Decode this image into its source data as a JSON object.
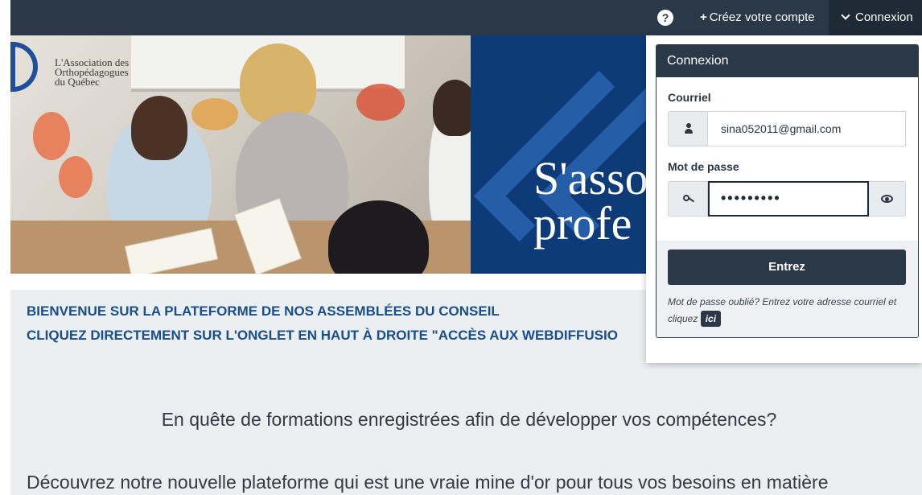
{
  "nav": {
    "help_glyph": "?",
    "create_account_label": "Créez votre compte",
    "login_label": "Connexion"
  },
  "banner": {
    "logo_lines": [
      "L'Association des",
      "Orthopédagogues",
      "du Québec"
    ],
    "slogan_lines": [
      "S'asso",
      "profe"
    ]
  },
  "content": {
    "welcome_line1": "BIENVENUE SUR LA PLATEFORME DE NOS ASSEMBLÉES DU CONSEIL",
    "welcome_line2": "CLIQUEZ DIRECTEMENT SUR L'ONGLET  EN HAUT À DROITE \"ACCÈS AUX WEBDIFFUSIO",
    "lead": "En quête de formations enregistrées afin de développer vos compétences?",
    "lead2": "Découvrez notre nouvelle plateforme qui est une vraie mine d'or pour tous vos besoins en matière"
  },
  "login": {
    "title": "Connexion",
    "email_label": "Courriel",
    "email_value": "sina052011@gmail.com",
    "password_label": "Mot de passe",
    "password_value": "•••••••••",
    "submit_label": "Entrez",
    "forgot_text": "Mot de passe oublié? Entrez votre adresse courriel et cliquez",
    "forgot_link": "ici"
  },
  "colors": {
    "navbar": "#2b3848",
    "accent_blue": "#1a4e8a",
    "banner_blue": "#0d3b78"
  },
  "icons": [
    "help-icon",
    "plus-icon",
    "chevron-down-icon",
    "user-icon",
    "key-icon",
    "eye-icon"
  ]
}
